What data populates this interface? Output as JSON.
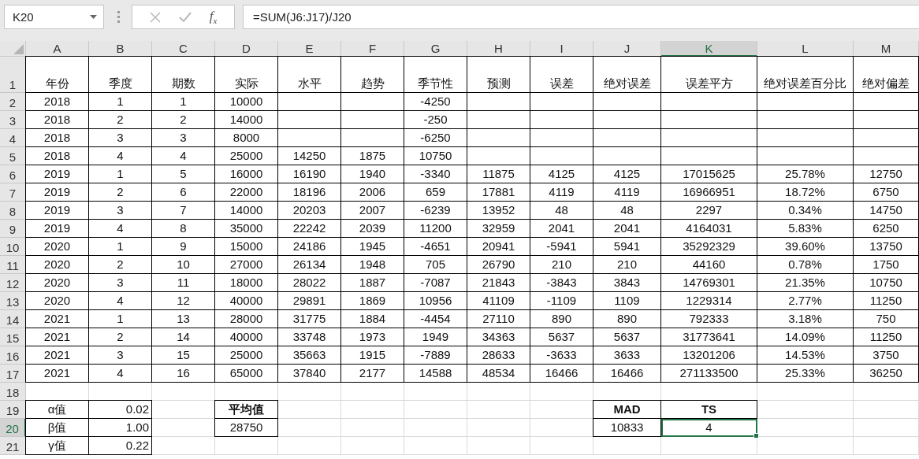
{
  "name_box": "K20",
  "formula_bar": {
    "function_label": "f$_{x}$",
    "formula": "=SUM(J6:J17)/J20"
  },
  "columns": [
    {
      "label": "A",
      "selected": false
    },
    {
      "label": "B",
      "selected": false
    },
    {
      "label": "C",
      "selected": false
    },
    {
      "label": "D",
      "selected": false
    },
    {
      "label": "E",
      "selected": false
    },
    {
      "label": "F",
      "selected": false
    },
    {
      "label": "G",
      "selected": false
    },
    {
      "label": "H",
      "selected": false
    },
    {
      "label": "I",
      "selected": false
    },
    {
      "label": "J",
      "selected": false
    },
    {
      "label": "K",
      "selected": true
    },
    {
      "label": "L",
      "selected": false
    },
    {
      "label": "M",
      "selected": false
    }
  ],
  "rows": [
    {
      "label": "1",
      "selected": false,
      "kind": "table",
      "cells": [
        {
          "text": "年份"
        },
        {
          "text": "季度"
        },
        {
          "text": "期数"
        },
        {
          "text": "实际"
        },
        {
          "text": "水平"
        },
        {
          "text": "趋势"
        },
        {
          "text": "季节性"
        },
        {
          "text": "预测"
        },
        {
          "text": "误差"
        },
        {
          "text": "绝对误差"
        },
        {
          "text": "误差平方"
        },
        {
          "text": "绝对误差百分比"
        },
        {
          "text": "绝对偏差"
        }
      ]
    },
    {
      "label": "2",
      "selected": false,
      "kind": "table",
      "cells": [
        {
          "text": "2018"
        },
        {
          "text": "1"
        },
        {
          "text": "1"
        },
        {
          "text": "10000"
        },
        {
          "kind": "empty"
        },
        {
          "kind": "empty"
        },
        {
          "text": "-4250"
        }
      ]
    },
    {
      "label": "3",
      "selected": false,
      "kind": "table",
      "cells": [
        {
          "text": "2018"
        },
        {
          "text": "2"
        },
        {
          "text": "2"
        },
        {
          "text": "14000"
        },
        {
          "kind": "empty"
        },
        {
          "kind": "empty"
        },
        {
          "text": "-250"
        }
      ]
    },
    {
      "label": "4",
      "selected": false,
      "kind": "table",
      "cells": [
        {
          "text": "2018"
        },
        {
          "text": "3"
        },
        {
          "text": "3"
        },
        {
          "text": "8000"
        },
        {
          "kind": "empty"
        },
        {
          "kind": "empty"
        },
        {
          "text": "-6250"
        }
      ]
    },
    {
      "label": "5",
      "selected": false,
      "kind": "table",
      "cells": [
        {
          "text": "2018"
        },
        {
          "text": "4"
        },
        {
          "text": "4"
        },
        {
          "text": "25000"
        },
        {
          "text": "14250"
        },
        {
          "text": "1875"
        },
        {
          "text": "10750"
        }
      ]
    },
    {
      "label": "6",
      "selected": false,
      "kind": "table",
      "cells": [
        {
          "text": "2019"
        },
        {
          "text": "1"
        },
        {
          "text": "5"
        },
        {
          "text": "16000"
        },
        {
          "text": "16190"
        },
        {
          "text": "1940"
        },
        {
          "text": "-3340"
        },
        {
          "text": "11875"
        },
        {
          "text": "4125"
        },
        {
          "text": "4125"
        },
        {
          "text": "17015625"
        },
        {
          "text": "25.78%"
        },
        {
          "text": "12750"
        }
      ]
    },
    {
      "label": "7",
      "selected": false,
      "kind": "table",
      "cells": [
        {
          "text": "2019"
        },
        {
          "text": "2"
        },
        {
          "text": "6"
        },
        {
          "text": "22000"
        },
        {
          "text": "18196"
        },
        {
          "text": "2006"
        },
        {
          "text": "659"
        },
        {
          "text": "17881"
        },
        {
          "text": "4119"
        },
        {
          "text": "4119"
        },
        {
          "text": "16966951"
        },
        {
          "text": "18.72%"
        },
        {
          "text": "6750"
        }
      ]
    },
    {
      "label": "8",
      "selected": false,
      "kind": "table",
      "cells": [
        {
          "text": "2019"
        },
        {
          "text": "3"
        },
        {
          "text": "7"
        },
        {
          "text": "14000"
        },
        {
          "text": "20203"
        },
        {
          "text": "2007"
        },
        {
          "text": "-6239"
        },
        {
          "text": "13952"
        },
        {
          "text": "48"
        },
        {
          "text": "48"
        },
        {
          "text": "2297"
        },
        {
          "text": "0.34%"
        },
        {
          "text": "14750"
        }
      ]
    },
    {
      "label": "9",
      "selected": false,
      "kind": "table",
      "cells": [
        {
          "text": "2019"
        },
        {
          "text": "4"
        },
        {
          "text": "8"
        },
        {
          "text": "35000"
        },
        {
          "text": "22242"
        },
        {
          "text": "2039"
        },
        {
          "text": "11200"
        },
        {
          "text": "32959"
        },
        {
          "text": "2041"
        },
        {
          "text": "2041"
        },
        {
          "text": "4164031"
        },
        {
          "text": "5.83%"
        },
        {
          "text": "6250"
        }
      ]
    },
    {
      "label": "10",
      "selected": false,
      "kind": "table",
      "cells": [
        {
          "text": "2020"
        },
        {
          "text": "1"
        },
        {
          "text": "9"
        },
        {
          "text": "15000"
        },
        {
          "text": "24186"
        },
        {
          "text": "1945"
        },
        {
          "text": "-4651"
        },
        {
          "text": "20941"
        },
        {
          "text": "-5941"
        },
        {
          "text": "5941"
        },
        {
          "text": "35292329"
        },
        {
          "text": "39.60%"
        },
        {
          "text": "13750"
        }
      ]
    },
    {
      "label": "11",
      "selected": false,
      "kind": "table",
      "cells": [
        {
          "text": "2020"
        },
        {
          "text": "2"
        },
        {
          "text": "10"
        },
        {
          "text": "27000"
        },
        {
          "text": "26134"
        },
        {
          "text": "1948"
        },
        {
          "text": "705"
        },
        {
          "text": "26790"
        },
        {
          "text": "210"
        },
        {
          "text": "210"
        },
        {
          "text": "44160"
        },
        {
          "text": "0.78%"
        },
        {
          "text": "1750"
        }
      ]
    },
    {
      "label": "12",
      "selected": false,
      "kind": "table",
      "cells": [
        {
          "text": "2020"
        },
        {
          "text": "3"
        },
        {
          "text": "11"
        },
        {
          "text": "18000"
        },
        {
          "text": "28022"
        },
        {
          "text": "1887"
        },
        {
          "text": "-7087"
        },
        {
          "text": "21843"
        },
        {
          "text": "-3843"
        },
        {
          "text": "3843"
        },
        {
          "text": "14769301"
        },
        {
          "text": "21.35%"
        },
        {
          "text": "10750"
        }
      ]
    },
    {
      "label": "13",
      "selected": false,
      "kind": "table",
      "cells": [
        {
          "text": "2020"
        },
        {
          "text": "4"
        },
        {
          "text": "12"
        },
        {
          "text": "40000"
        },
        {
          "text": "29891"
        },
        {
          "text": "1869"
        },
        {
          "text": "10956"
        },
        {
          "text": "41109"
        },
        {
          "text": "-1109"
        },
        {
          "text": "1109"
        },
        {
          "text": "1229314"
        },
        {
          "text": "2.77%"
        },
        {
          "text": "11250"
        }
      ]
    },
    {
      "label": "14",
      "selected": false,
      "kind": "table",
      "cells": [
        {
          "text": "2021"
        },
        {
          "text": "1"
        },
        {
          "text": "13"
        },
        {
          "text": "28000"
        },
        {
          "text": "31775"
        },
        {
          "text": "1884"
        },
        {
          "text": "-4454"
        },
        {
          "text": "27110"
        },
        {
          "text": "890"
        },
        {
          "text": "890"
        },
        {
          "text": "792333"
        },
        {
          "text": "3.18%"
        },
        {
          "text": "750"
        }
      ]
    },
    {
      "label": "15",
      "selected": false,
      "kind": "table",
      "cells": [
        {
          "text": "2021"
        },
        {
          "text": "2"
        },
        {
          "text": "14"
        },
        {
          "text": "40000"
        },
        {
          "text": "33748"
        },
        {
          "text": "1973"
        },
        {
          "text": "1949"
        },
        {
          "text": "34363"
        },
        {
          "text": "5637"
        },
        {
          "text": "5637"
        },
        {
          "text": "31773641"
        },
        {
          "text": "14.09%"
        },
        {
          "text": "11250"
        }
      ]
    },
    {
      "label": "16",
      "selected": false,
      "kind": "table",
      "cells": [
        {
          "text": "2021"
        },
        {
          "text": "3"
        },
        {
          "text": "15"
        },
        {
          "text": "25000"
        },
        {
          "text": "35663"
        },
        {
          "text": "1915"
        },
        {
          "text": "-7889"
        },
        {
          "text": "28633"
        },
        {
          "text": "-3633"
        },
        {
          "text": "3633"
        },
        {
          "text": "13201206"
        },
        {
          "text": "14.53%"
        },
        {
          "text": "3750"
        }
      ]
    },
    {
      "label": "17",
      "selected": false,
      "kind": "table",
      "cells": [
        {
          "text": "2021"
        },
        {
          "text": "4"
        },
        {
          "text": "16"
        },
        {
          "text": "65000"
        },
        {
          "text": "37840"
        },
        {
          "text": "2177"
        },
        {
          "text": "14588"
        },
        {
          "text": "48534"
        },
        {
          "text": "16466"
        },
        {
          "text": "16466"
        },
        {
          "text": "271133500"
        },
        {
          "text": "25.33%"
        },
        {
          "text": "36250"
        }
      ]
    },
    {
      "label": "18",
      "selected": false,
      "kind": "plain",
      "cells": []
    },
    {
      "label": "19",
      "selected": false,
      "kind": "summary",
      "cells": [
        {
          "text": "α值"
        },
        {
          "text": "0.02",
          "kind": "number"
        },
        {
          "kind": "empty"
        },
        {
          "text": "平均值",
          "kind": "header"
        },
        {
          "kind": "empty"
        },
        {
          "kind": "empty"
        },
        {
          "kind": "empty"
        },
        {
          "kind": "empty"
        },
        {
          "kind": "empty"
        },
        {
          "text": "MAD",
          "kind": "header"
        },
        {
          "text": "TS",
          "kind": "header"
        }
      ]
    },
    {
      "label": "20",
      "selected": true,
      "kind": "summary",
      "cells": [
        {
          "text": "β值"
        },
        {
          "text": "1.00",
          "kind": "number"
        },
        {
          "kind": "empty"
        },
        {
          "text": "28750"
        },
        {
          "kind": "empty"
        },
        {
          "kind": "empty"
        },
        {
          "kind": "empty"
        },
        {
          "kind": "empty"
        },
        {
          "kind": "empty"
        },
        {
          "text": "10833"
        },
        {
          "text": "4"
        }
      ]
    },
    {
      "label": "21",
      "selected": false,
      "kind": "summary",
      "cells": [
        {
          "text": "γ值"
        },
        {
          "text": "0.22",
          "kind": "number"
        }
      ]
    }
  ]
}
